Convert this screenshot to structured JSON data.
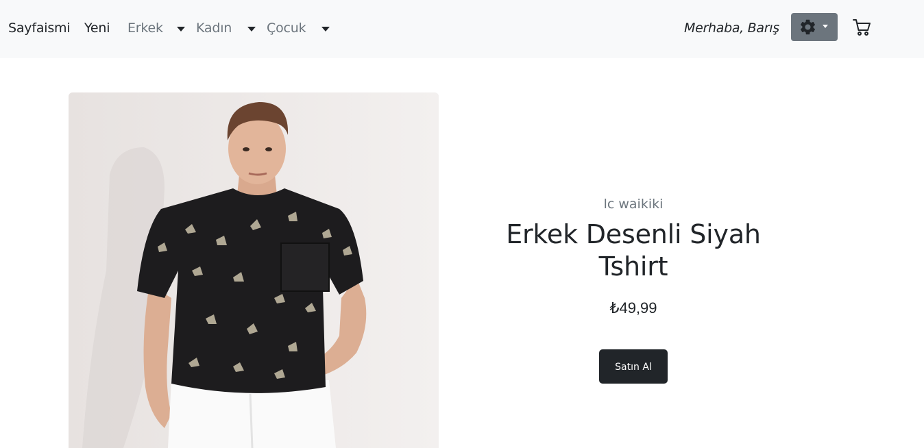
{
  "navbar": {
    "brand": "Sayfaismi",
    "links": {
      "new": "Yeni",
      "men": "Erkek",
      "women": "Kadın",
      "kids": "Çocuk"
    },
    "greeting": "Merhaba, Barış",
    "settings_icon": "gear-icon",
    "cart_icon": "cart-icon"
  },
  "product": {
    "brand": "lc waikiki",
    "title": "Erkek Desenli Siyah Tshirt",
    "price": "₺49,99",
    "buy_label": "Satın Al"
  },
  "colors": {
    "navbar_bg": "#f8f9fa",
    "muted_text": "#6c757d",
    "dark": "#212529",
    "settings_button": "#6c757d"
  }
}
